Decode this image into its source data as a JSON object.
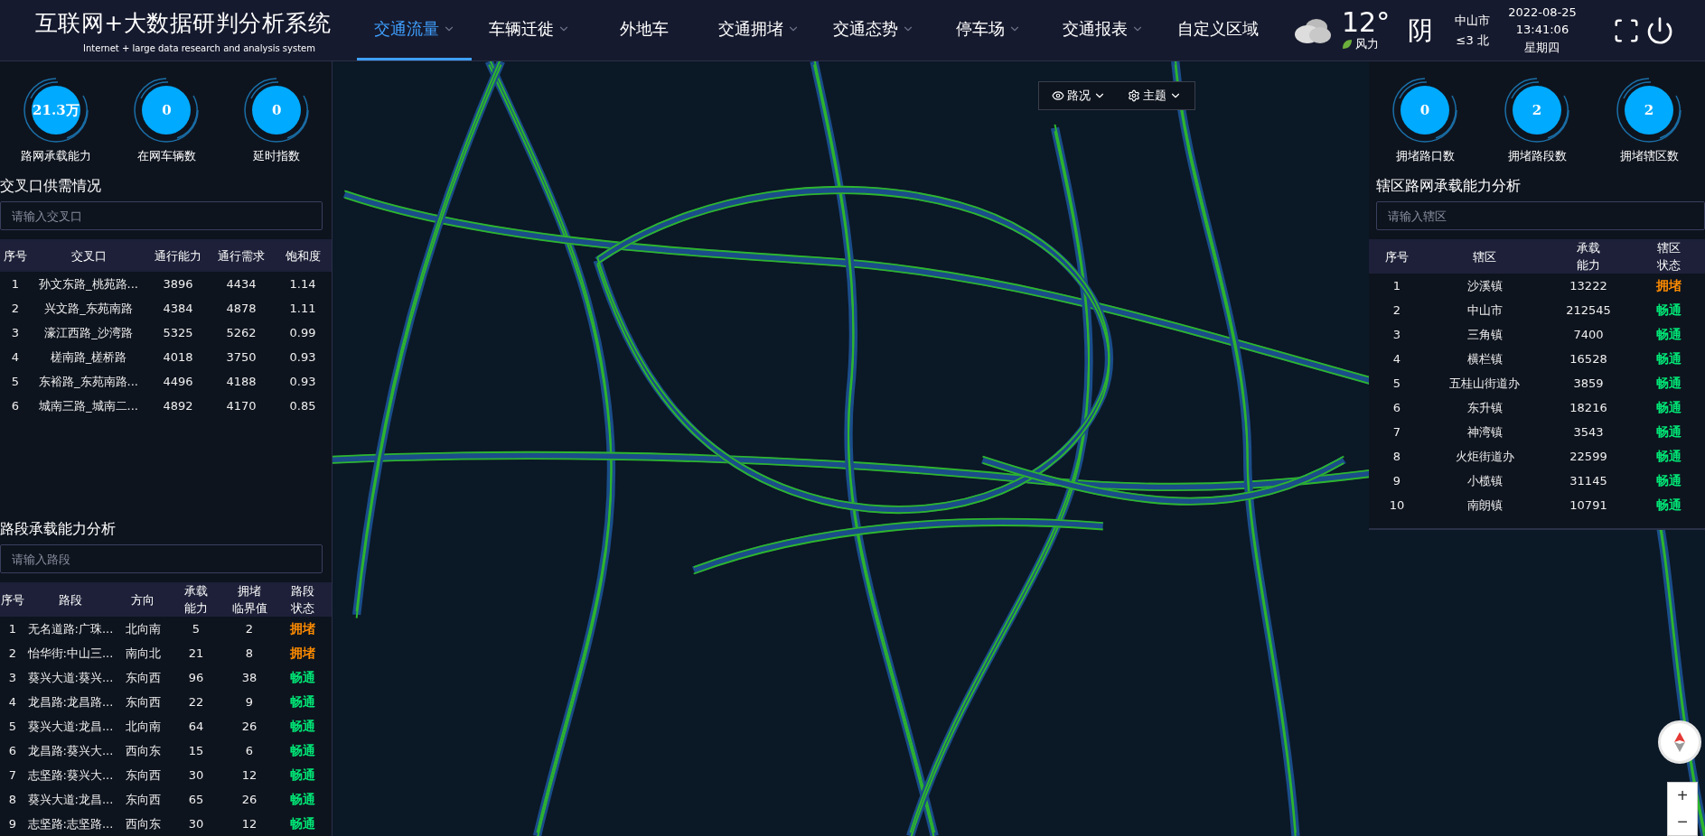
{
  "header": {
    "title": "互联网+大数据研判分析系统",
    "subtitle": "Internet + large data research and analysis system",
    "nav": [
      {
        "label": "交通流量",
        "selected": true,
        "dropdown": true
      },
      {
        "label": "车辆迁徙",
        "selected": false,
        "dropdown": true
      },
      {
        "label": "外地车",
        "selected": false,
        "dropdown": false
      },
      {
        "label": "交通拥堵",
        "selected": false,
        "dropdown": true
      },
      {
        "label": "交通态势",
        "selected": false,
        "dropdown": true
      },
      {
        "label": "停车场",
        "selected": false,
        "dropdown": true
      },
      {
        "label": "交通报表",
        "selected": false,
        "dropdown": true
      },
      {
        "label": "自定义区域",
        "selected": false,
        "dropdown": false
      }
    ],
    "weather": {
      "temperature": "12°",
      "wind_label": "风力",
      "condition": "阴",
      "city": "中山市",
      "wind": "≤3 北"
    },
    "datetime": {
      "date": "2022-08-25",
      "time": "13:41:06",
      "weekday": "星期四"
    }
  },
  "left_panel": {
    "stats": [
      {
        "value": "21.3万",
        "label": "路网承载能力"
      },
      {
        "value": "0",
        "label": "在网车辆数"
      },
      {
        "value": "0",
        "label": "延时指数"
      }
    ],
    "intersections": {
      "title": "交叉口供需情况",
      "placeholder": "请输入交叉口",
      "columns": [
        "序号",
        "交叉口",
        "通行能力",
        "通行需求",
        "饱和度"
      ],
      "rows": [
        [
          "1",
          "孙文东路_桃苑路...",
          "3896",
          "4434",
          "1.14"
        ],
        [
          "2",
          "兴文路_东苑南路",
          "4384",
          "4878",
          "1.11"
        ],
        [
          "3",
          "濠江西路_沙湾路",
          "5325",
          "5262",
          "0.99"
        ],
        [
          "4",
          "槎南路_槎桥路",
          "4018",
          "3750",
          "0.93"
        ],
        [
          "5",
          "东裕路_东苑南路...",
          "4496",
          "4188",
          "0.93"
        ],
        [
          "6",
          "城南三路_城南二...",
          "4892",
          "4170",
          "0.85"
        ]
      ]
    },
    "segments": {
      "title": "路段承载能力分析",
      "placeholder": "请输入路段",
      "columns": [
        "序号",
        "路段",
        "方向",
        [
          "承载",
          "能力"
        ],
        [
          "拥堵",
          "临界值"
        ],
        [
          "路段",
          "状态"
        ]
      ],
      "rows": [
        {
          "cells": [
            "1",
            "无名道路:广珠...",
            "北向南",
            "5",
            "2"
          ],
          "status": {
            "text": "拥堵",
            "color": "#ff8c00"
          }
        },
        {
          "cells": [
            "2",
            "怡华街:中山三...",
            "南向北",
            "21",
            "8"
          ],
          "status": {
            "text": "拥堵",
            "color": "#ff8c00"
          }
        },
        {
          "cells": [
            "3",
            "葵兴大道:葵兴...",
            "东向西",
            "96",
            "38"
          ],
          "status": {
            "text": "畅通",
            "color": "#00e676"
          }
        },
        {
          "cells": [
            "4",
            "龙昌路:龙昌路...",
            "东向西",
            "22",
            "9"
          ],
          "status": {
            "text": "畅通",
            "color": "#00e676"
          }
        },
        {
          "cells": [
            "5",
            "葵兴大道:龙昌...",
            "北向南",
            "64",
            "26"
          ],
          "status": {
            "text": "畅通",
            "color": "#00e676"
          }
        },
        {
          "cells": [
            "6",
            "龙昌路:葵兴大...",
            "西向东",
            "15",
            "6"
          ],
          "status": {
            "text": "畅通",
            "color": "#00e676"
          }
        },
        {
          "cells": [
            "7",
            "志坚路:葵兴大...",
            "东向西",
            "30",
            "12"
          ],
          "status": {
            "text": "畅通",
            "color": "#00e676"
          }
        },
        {
          "cells": [
            "8",
            "葵兴大道:龙昌...",
            "东向西",
            "65",
            "26"
          ],
          "status": {
            "text": "畅通",
            "color": "#00e676"
          }
        },
        {
          "cells": [
            "9",
            "志坚路:志坚路...",
            "西向东",
            "30",
            "12"
          ],
          "status": {
            "text": "畅通",
            "color": "#00e676"
          }
        }
      ]
    }
  },
  "map": {
    "controls": [
      {
        "label": "路况"
      },
      {
        "label": "主题"
      }
    ],
    "zoom": [
      "+",
      "−"
    ]
  },
  "right_panel": {
    "stats": [
      {
        "value": "0",
        "label": "拥堵路口数"
      },
      {
        "value": "2",
        "label": "拥堵路段数"
      },
      {
        "value": "2",
        "label": "拥堵辖区数"
      }
    ],
    "districts": {
      "title": "辖区路网承载能力分析",
      "placeholder": "请输入辖区",
      "columns": [
        "序号",
        "辖区",
        [
          "承载",
          "能力"
        ],
        [
          "辖区",
          "状态"
        ]
      ],
      "rows": [
        {
          "cells": [
            "1",
            "沙溪镇",
            "13222"
          ],
          "status": {
            "text": "拥堵",
            "color": "#ff8c00"
          }
        },
        {
          "cells": [
            "2",
            "中山市",
            "212545"
          ],
          "status": {
            "text": "畅通",
            "color": "#00e676"
          }
        },
        {
          "cells": [
            "3",
            "三角镇",
            "7400"
          ],
          "status": {
            "text": "畅通",
            "color": "#00e676"
          }
        },
        {
          "cells": [
            "4",
            "横栏镇",
            "16528"
          ],
          "status": {
            "text": "畅通",
            "color": "#00e676"
          }
        },
        {
          "cells": [
            "5",
            "五桂山街道办",
            "3859"
          ],
          "status": {
            "text": "畅通",
            "color": "#00e676"
          }
        },
        {
          "cells": [
            "6",
            "东升镇",
            "18216"
          ],
          "status": {
            "text": "畅通",
            "color": "#00e676"
          }
        },
        {
          "cells": [
            "7",
            "神湾镇",
            "3543"
          ],
          "status": {
            "text": "畅通",
            "color": "#00e676"
          }
        },
        {
          "cells": [
            "8",
            "火炬街道办",
            "22599"
          ],
          "status": {
            "text": "畅通",
            "color": "#00e676"
          }
        },
        {
          "cells": [
            "9",
            "小榄镇",
            "31145"
          ],
          "status": {
            "text": "畅通",
            "color": "#00e676"
          }
        },
        {
          "cells": [
            "10",
            "南朗镇",
            "10791"
          ],
          "status": {
            "text": "畅通",
            "color": "#00e676"
          }
        }
      ]
    }
  }
}
